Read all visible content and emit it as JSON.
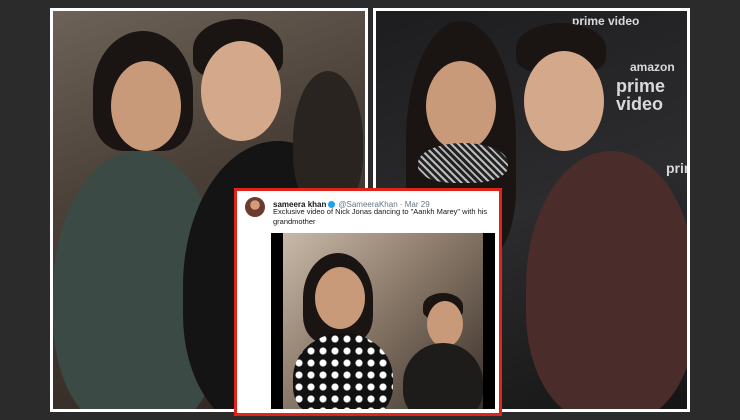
{
  "left_photo": {
    "description_icon": "couple-photo-icon"
  },
  "right_photo": {
    "backdrop_text_1": "prime video",
    "backdrop_text_2": "amazon",
    "backdrop_text_3": "prime video",
    "backdrop_text_4": "prim"
  },
  "tweet": {
    "display_name": "sameera khan",
    "handle": "@SameeraKhan · Mar 29",
    "text": "Exclusive video of Nick Jonas dancing to \"Aankh Marey\" with his grandmother",
    "border_color": "#e2231a"
  }
}
